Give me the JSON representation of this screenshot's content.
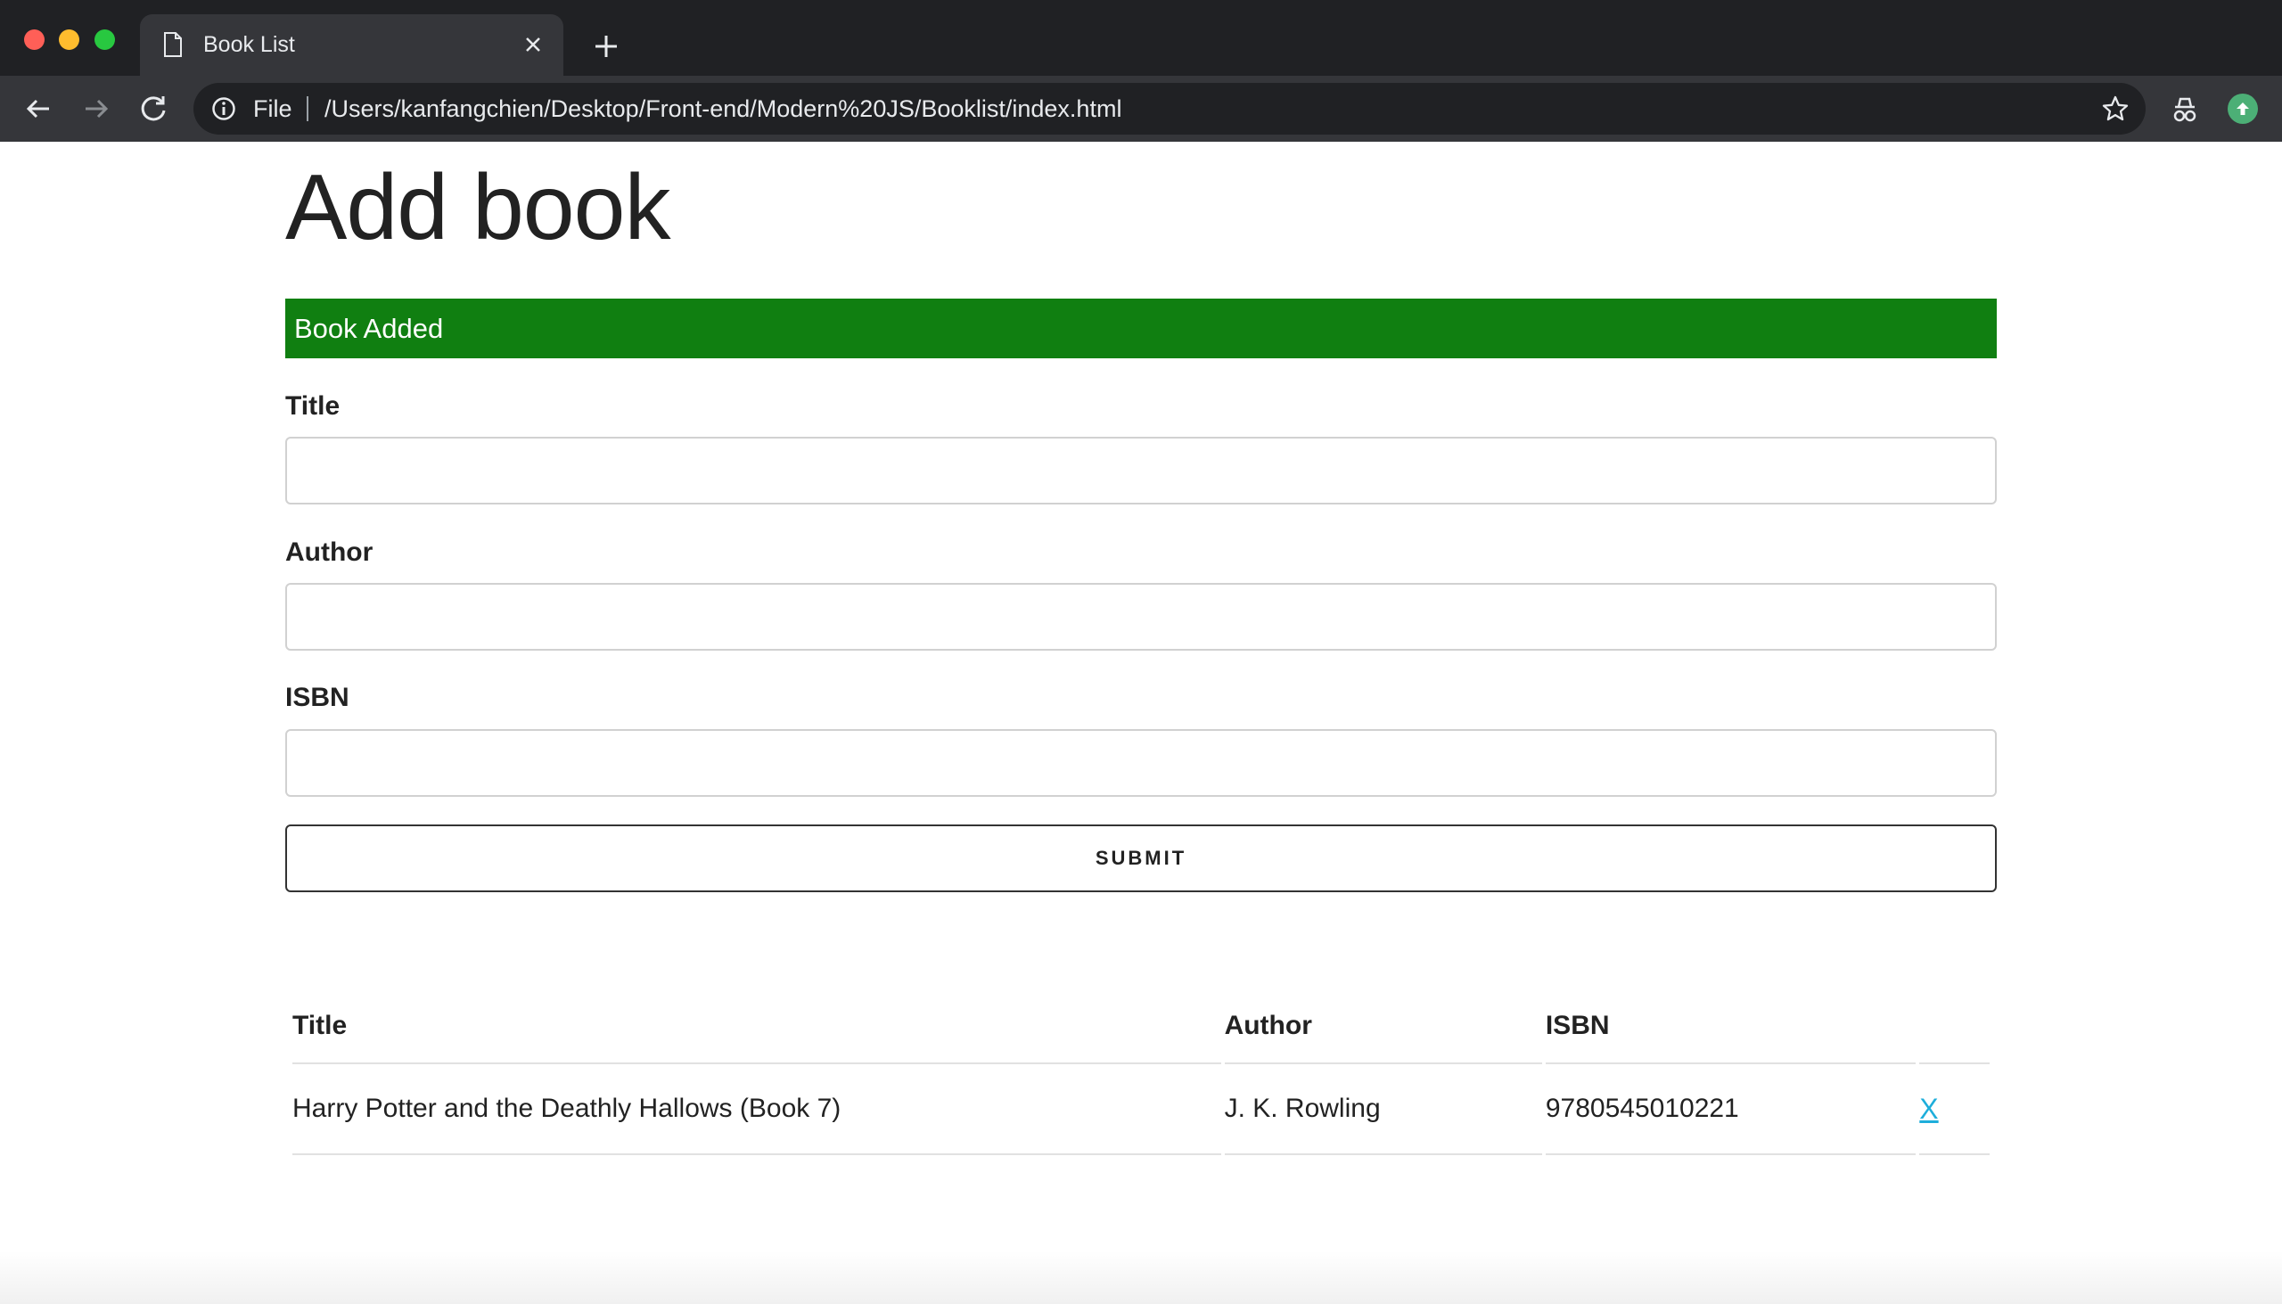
{
  "browser": {
    "tab_title": "Book List",
    "scheme_label": "File",
    "url": "/Users/kanfangchien/Desktop/Front-end/Modern%20JS/Booklist/index.html"
  },
  "page": {
    "heading": "Add book",
    "alert": {
      "text": "Book Added",
      "color": "#107f11"
    },
    "form": {
      "title_label": "Title",
      "title_value": "",
      "author_label": "Author",
      "author_value": "",
      "isbn_label": "ISBN",
      "isbn_value": "",
      "submit_label": "SUBMIT"
    },
    "table": {
      "headers": [
        "Title",
        "Author",
        "ISBN"
      ],
      "rows": [
        {
          "title": "Harry Potter and the Deathly Hallows (Book 7)",
          "author": "J. K. Rowling",
          "isbn": "9780545010221",
          "delete": "X"
        }
      ]
    }
  },
  "icons": [
    "document-icon",
    "close-icon",
    "plus-icon",
    "back-arrow-icon",
    "forward-arrow-icon",
    "reload-icon",
    "info-icon",
    "star-icon",
    "incognito-icon",
    "profile-icon"
  ]
}
